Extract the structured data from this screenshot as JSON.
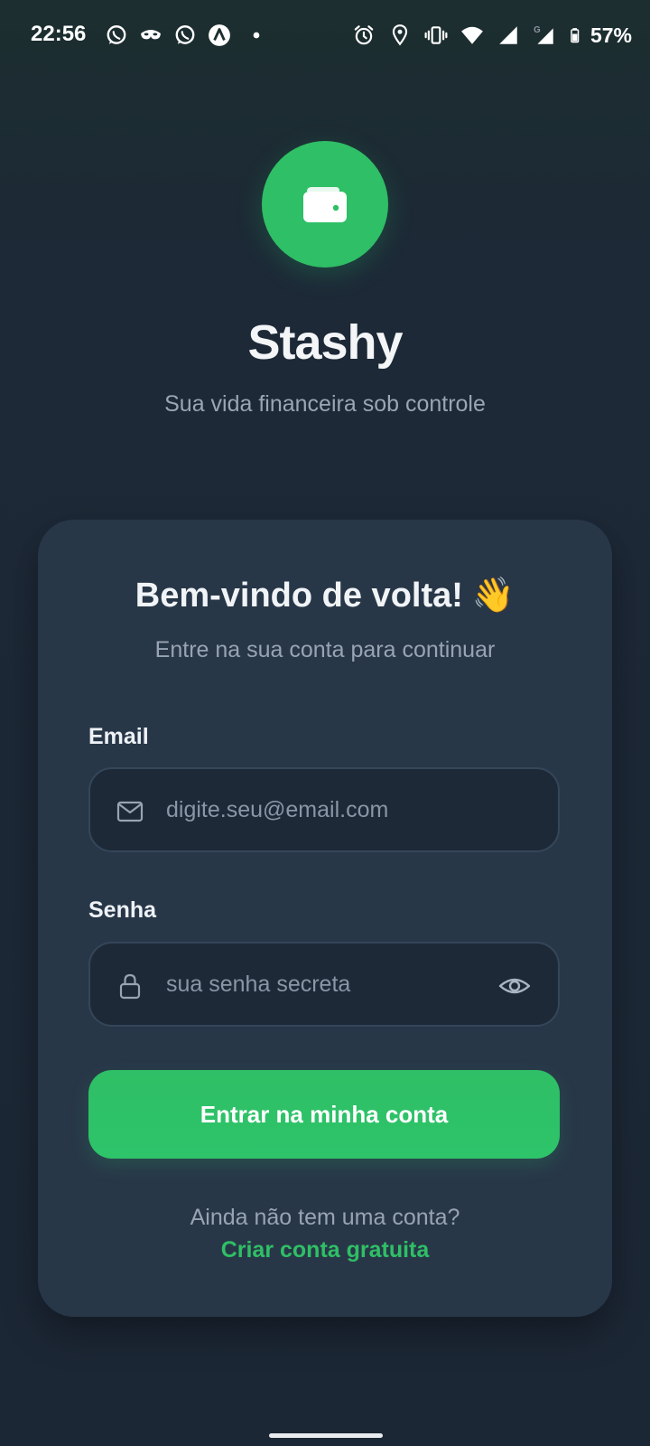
{
  "status_bar": {
    "time": "22:56",
    "left_icons": [
      "whatsapp-icon",
      "spy-mask-icon",
      "whatsapp-icon",
      "app-logo-icon",
      "notification-dot-icon"
    ],
    "right_icons": [
      "alarm-icon",
      "location-pin-icon",
      "vibrate-icon",
      "wifi-icon",
      "signal-icon",
      "signal-g-icon",
      "battery-icon"
    ],
    "battery_percent": "57%",
    "network_type": "G"
  },
  "app": {
    "logo_icon": "wallet-icon",
    "name": "Stashy",
    "tagline": "Sua vida financeira sob controle",
    "accent_color": "#2fbf66"
  },
  "login_card": {
    "heading": "Bem-vindo de volta!",
    "heading_emoji": "👋",
    "subheading": "Entre na sua conta para continuar",
    "email": {
      "label": "Email",
      "icon": "mail-icon",
      "value": "",
      "placeholder": "digite.seu@email.com"
    },
    "password": {
      "label": "Senha",
      "icon": "lock-icon",
      "value": "",
      "placeholder": "sua senha secreta",
      "toggle_icon": "eye-icon"
    },
    "submit_label": "Entrar na minha conta",
    "signup_prompt": "Ainda não tem uma conta?",
    "signup_link": "Criar conta gratuita"
  }
}
